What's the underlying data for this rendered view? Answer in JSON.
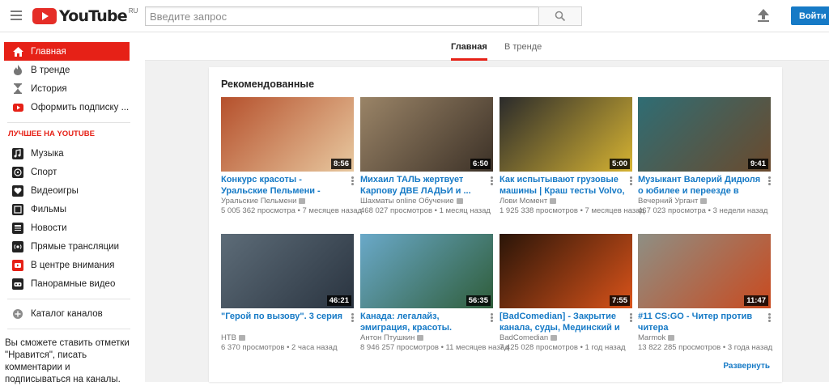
{
  "header": {
    "logo_text": "YouTube",
    "logo_country": "RU",
    "search_placeholder": "Введите запрос",
    "signin_label": "Войти"
  },
  "sidebar": {
    "primary": [
      {
        "label": "Главная",
        "icon": "home-icon",
        "active": true
      },
      {
        "label": "В тренде",
        "icon": "flame-icon"
      },
      {
        "label": "История",
        "icon": "hourglass-icon"
      },
      {
        "label": "Оформить подписку ...",
        "icon": "youtube-red-icon"
      }
    ],
    "best_heading": "ЛУЧШЕЕ НА YOUTUBE",
    "categories": [
      {
        "label": "Музыка",
        "icon": "music-icon"
      },
      {
        "label": "Спорт",
        "icon": "sport-icon"
      },
      {
        "label": "Видеоигры",
        "icon": "gaming-icon"
      },
      {
        "label": "Фильмы",
        "icon": "film-icon"
      },
      {
        "label": "Новости",
        "icon": "news-icon"
      },
      {
        "label": "Прямые трансляции",
        "icon": "live-icon"
      },
      {
        "label": "В центре внимания",
        "icon": "spotlight-icon"
      },
      {
        "label": "Панорамные видео",
        "icon": "vr-icon"
      }
    ],
    "catalog_label": "Каталог каналов",
    "promo_text": "Вы сможете ставить отметки \"Нравится\", писать комментарии и подписываться на каналы."
  },
  "tabs": [
    {
      "label": "Главная",
      "active": true
    },
    {
      "label": "В тренде",
      "active": false
    }
  ],
  "shelf": {
    "title": "Рекомендованные",
    "expand_label": "Развернуть",
    "videos": [
      {
        "title": "Конкурс красоты - Уральские Пельмени - Азбука Уральских ...",
        "channel": "Уральские Пельмени",
        "views": "5 005 362 просмотра",
        "age": "• 7 месяцев назад",
        "duration": "8:56",
        "thumb_colors": [
          "#b5502c",
          "#e8c9a0"
        ]
      },
      {
        "title": "Михаил ТАЛЬ жертвует Карпову ДВЕ ЛАДЬИ и ...",
        "channel": "Шахматы online Обучение",
        "views": "468 027 просмотров",
        "age": "• 1 месяц назад",
        "duration": "6:50",
        "thumb_colors": [
          "#9a8467",
          "#3c3127"
        ]
      },
      {
        "title": "Как испытывают грузовые машины | Краш тесты Volvo, ...",
        "channel": "Лови Момент",
        "views": "1 925 338 просмотров",
        "age": "• 7 месяцев назад",
        "duration": "5:00",
        "thumb_colors": [
          "#2b2b2b",
          "#d6b332"
        ]
      },
      {
        "title": "Музыкант Валерий Дидюля о юбилее и переезде в Москву. ...",
        "channel": "Вечерний Ургант",
        "views": "467 023 просмотра",
        "age": "• 3 недели назад",
        "duration": "9:41",
        "thumb_colors": [
          "#2f6d74",
          "#6b4a2d"
        ]
      },
      {
        "title": "\"Герой по вызову\". 3 серия",
        "channel": "НТВ",
        "views": "6 370 просмотров",
        "age": "• 2 часа назад",
        "duration": "46:21",
        "thumb_colors": [
          "#5d6c78",
          "#2a3440"
        ]
      },
      {
        "title": "Канада: легалайз, эмиграция, красоты. Большой выпуск.",
        "channel": "Антон Птушкин",
        "views": "8 946 257 просмотров",
        "age": "• 11 месяцев назад",
        "duration": "56:35",
        "thumb_colors": [
          "#6aa9c9",
          "#2f5d3a"
        ]
      },
      {
        "title": "[BadComedian] - Закрытие канала, суды, Мединский и ...",
        "channel": "BadComedian",
        "views": "7 425 028 просмотров",
        "age": "• 1 год назад",
        "duration": "7:55",
        "thumb_colors": [
          "#2a1508",
          "#d9531a"
        ]
      },
      {
        "title": "#11 CS:GO - Читер против читера",
        "channel": "Marmok",
        "views": "13 822 285 просмотров",
        "age": "• 3 года назад",
        "duration": "11:47",
        "thumb_colors": [
          "#8e8f84",
          "#c94a1f"
        ]
      }
    ]
  }
}
